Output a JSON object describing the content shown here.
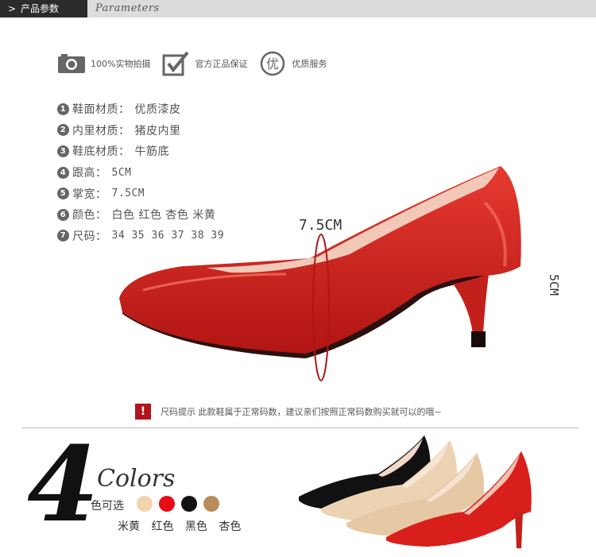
{
  "header": {
    "label": "产品参数",
    "arrow": ">",
    "subtitle": "Parameters"
  },
  "badges": [
    {
      "icon": "camera-icon",
      "text": "100%实物拍摄"
    },
    {
      "icon": "checkmark-icon",
      "text": "官方正品保证"
    },
    {
      "icon": "quality-icon",
      "glyph": "优",
      "text": "优质服务"
    }
  ],
  "specs": [
    {
      "num": "1",
      "label": "鞋面材质：",
      "value": "优质漆皮"
    },
    {
      "num": "2",
      "label": "内里材质：",
      "value": "猪皮内里"
    },
    {
      "num": "3",
      "label": "鞋底材质：",
      "value": "牛筋底"
    },
    {
      "num": "4",
      "label": "跟高：",
      "value": "5CM"
    },
    {
      "num": "5",
      "label": "掌宽：",
      "value": "7.5CM"
    },
    {
      "num": "6",
      "label": "颜色：",
      "value": "白色 红色 杏色 米黄"
    },
    {
      "num": "7",
      "label": "尺码：",
      "value": "34 35 36 37 38 39"
    }
  ],
  "dimensions": {
    "width": "7.5CM",
    "height": "5CM"
  },
  "tip": {
    "icon_glyph": "!",
    "text": "尺码提示 此款鞋属于正常码数，建议亲们按照正常码数购买就可以的哦~"
  },
  "colors_section": {
    "count": "4",
    "word": "Colors",
    "sub": "色可选",
    "swatches": [
      "#f1d3ae",
      "#e60d14",
      "#111111",
      "#b98c5c"
    ],
    "names": [
      "米黄",
      "红色",
      "黑色",
      "杏色"
    ]
  },
  "colors": {
    "shoe_red": "#d91f1c",
    "accent_red": "#b3131d",
    "header_dark": "#2b2b2b"
  }
}
